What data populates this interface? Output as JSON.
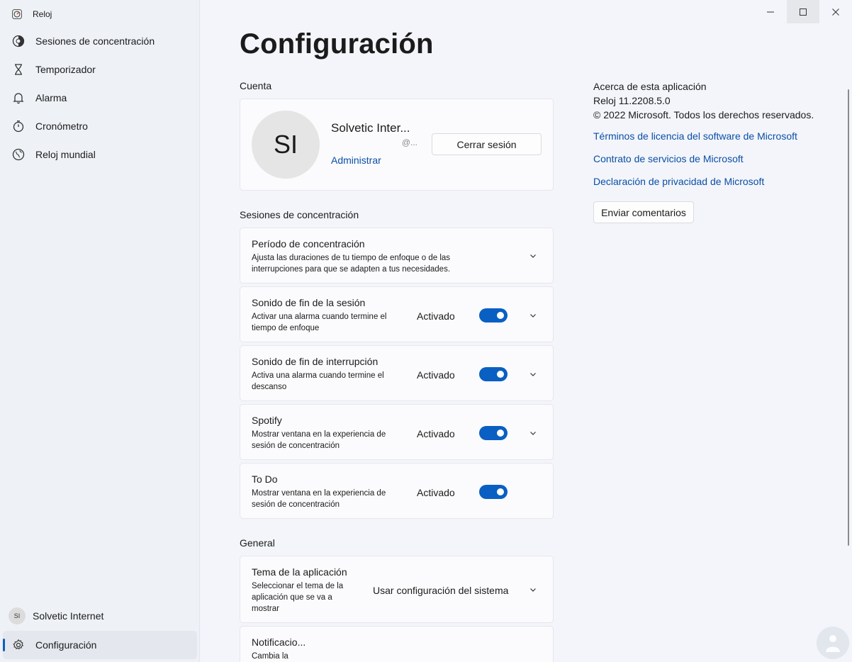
{
  "app": {
    "title": "Reloj"
  },
  "sidebar": {
    "items": [
      {
        "label": "Sesiones de concentración"
      },
      {
        "label": "Temporizador"
      },
      {
        "label": "Alarma"
      },
      {
        "label": "Cronómetro"
      },
      {
        "label": "Reloj mundial"
      }
    ],
    "user": {
      "initials": "SI",
      "name": "Solvetic Internet"
    },
    "settings_label": "Configuración"
  },
  "page": {
    "title": "Configuración"
  },
  "account": {
    "section_label": "Cuenta",
    "initials": "SI",
    "name": "Solvetic Inter...",
    "email": "@...",
    "manage_link": "Administrar",
    "logout_button": "Cerrar sesión"
  },
  "focus": {
    "section_label": "Sesiones de concentración",
    "period": {
      "title": "Período de concentración",
      "desc": "Ajusta las duraciones de tu tiempo de enfoque o de las interrupciones para que se adapten a tus necesidades."
    },
    "end_sound": {
      "title": "Sonido de fin de la sesión",
      "desc": "Activar una alarma cuando termine el tiempo de enfoque",
      "state": "Activado"
    },
    "break_sound": {
      "title": "Sonido de fin de interrupción",
      "desc": "Activa una alarma cuando termine el descanso",
      "state": "Activado"
    },
    "spotify": {
      "title": "Spotify",
      "desc": "Mostrar ventana en la experiencia de sesión de concentración",
      "state": "Activado"
    },
    "todo": {
      "title": "To Do",
      "desc": "Mostrar ventana en la experiencia de sesión de concentración",
      "state": "Activado"
    }
  },
  "general": {
    "section_label": "General",
    "theme": {
      "title": "Tema de la aplicación",
      "desc": "Seleccionar el tema de la aplicación que se va a mostrar",
      "value": "Usar configuración del sistema"
    },
    "notifications": {
      "title": "Notificacio...",
      "desc": "Cambia la"
    }
  },
  "about": {
    "heading": "Acerca de esta aplicación",
    "version": "Reloj 11.2208.5.0",
    "copyright": "© 2022 Microsoft. Todos los derechos reservados.",
    "links": [
      "Términos de licencia del software de Microsoft",
      "Contrato de servicios de Microsoft",
      "Declaración de privacidad de Microsoft"
    ],
    "feedback_button": "Enviar comentarios"
  },
  "colors": {
    "accent": "#0a5fc2",
    "link": "#0a4ea6"
  }
}
